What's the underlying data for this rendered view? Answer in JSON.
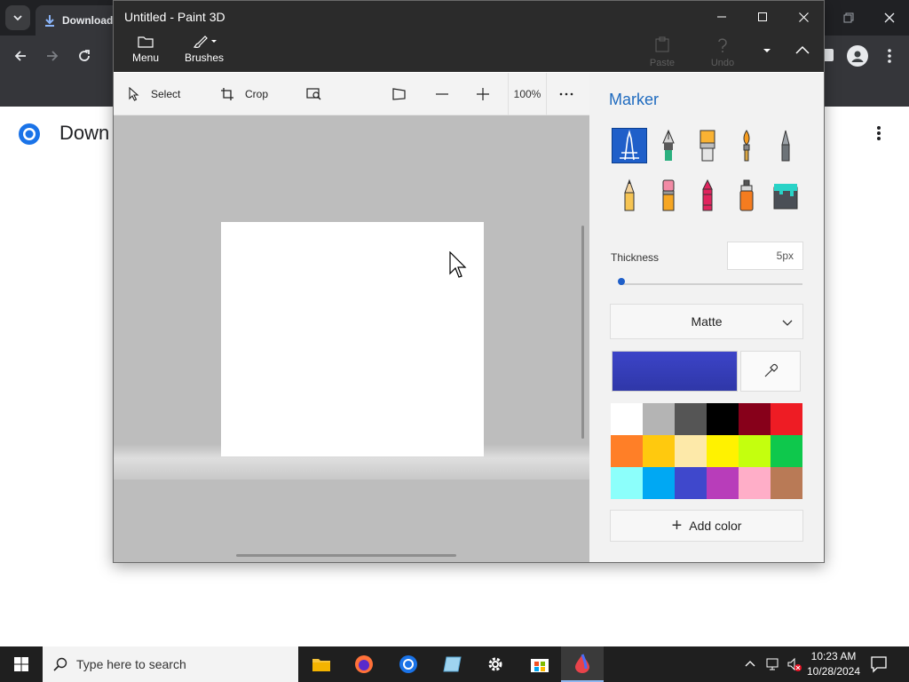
{
  "browser": {
    "tab_title": "Download",
    "page_heading": "Down"
  },
  "paint": {
    "window_title": "Untitled - Paint 3D",
    "ribbon": {
      "menu_label": "Menu",
      "brushes_label": "Brushes",
      "paste_label": "Paste",
      "undo_label": "Undo"
    },
    "toolbar": {
      "select_label": "Select",
      "crop_label": "Crop",
      "zoom_value": "100%"
    },
    "sidebar": {
      "title": "Marker",
      "brushes": [
        {
          "name": "marker",
          "selected": true
        },
        {
          "name": "calligraphy-pen",
          "selected": false
        },
        {
          "name": "oil-brush",
          "selected": false
        },
        {
          "name": "watercolor",
          "selected": false
        },
        {
          "name": "pixel-pen",
          "selected": false
        },
        {
          "name": "pencil",
          "selected": false
        },
        {
          "name": "eraser",
          "selected": false
        },
        {
          "name": "crayon",
          "selected": false
        },
        {
          "name": "spray-can",
          "selected": false
        },
        {
          "name": "fill",
          "selected": false
        }
      ],
      "thickness_label": "Thickness",
      "thickness_value": "5px",
      "finish_value": "Matte",
      "current_color": "#3c44c8",
      "palette": [
        "#ffffff",
        "#b4b4b4",
        "#555555",
        "#000000",
        "#87001a",
        "#ee1c24",
        "#ff7f27",
        "#ffc90e",
        "#fde9a9",
        "#fff200",
        "#c4ff0e",
        "#0ec84c",
        "#8cfffb",
        "#00a8f3",
        "#3f48cc",
        "#b83dba",
        "#ffaec8",
        "#b97a56"
      ],
      "add_color_label": "Add color"
    }
  },
  "taskbar": {
    "search_placeholder": "Type here to search",
    "time": "10:23 AM",
    "date": "10/28/2024"
  }
}
